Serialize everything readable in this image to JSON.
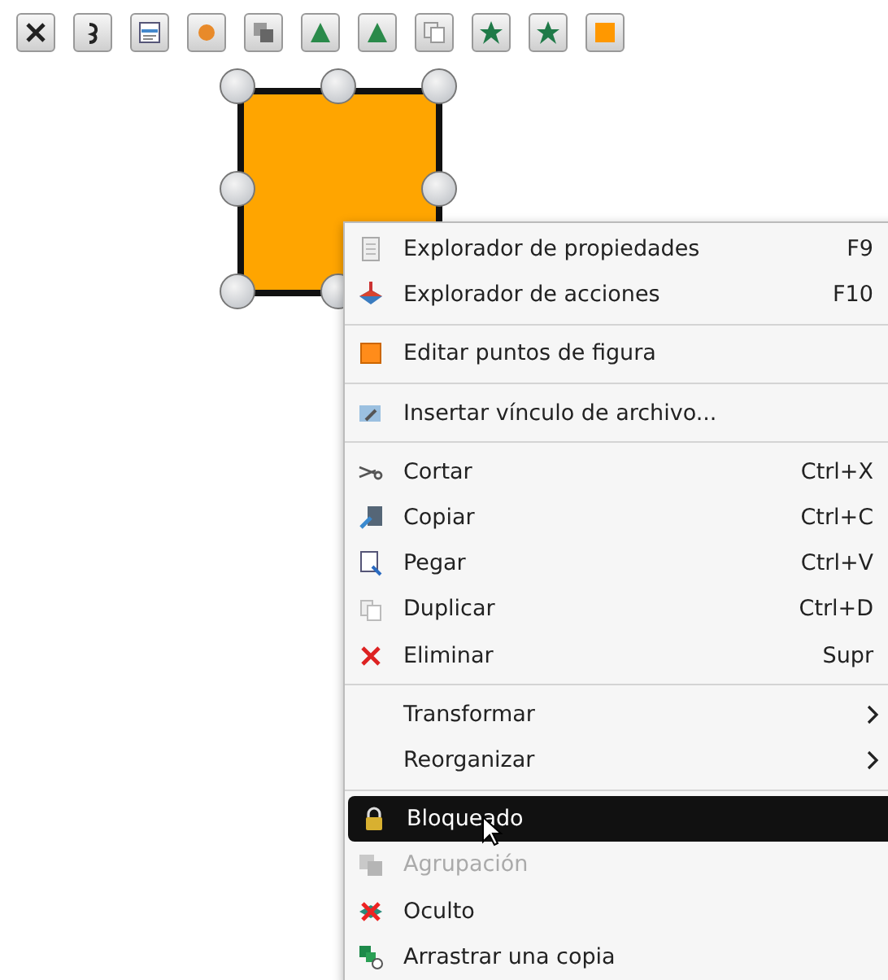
{
  "context_menu": {
    "items": [
      {
        "kind": "item",
        "label": "Explorador de propiedades",
        "shortcut": "F9",
        "selected": false,
        "disabled": false,
        "submenu": false
      },
      {
        "kind": "item",
        "label": "Explorador de acciones",
        "shortcut": "F10",
        "selected": false,
        "disabled": false,
        "submenu": false
      },
      {
        "kind": "separator"
      },
      {
        "kind": "item",
        "label": "Editar puntos de figura",
        "selected": false,
        "disabled": false,
        "submenu": false
      },
      {
        "kind": "separator"
      },
      {
        "kind": "item",
        "label": "Insertar vínculo de archivo...",
        "selected": false,
        "disabled": false,
        "submenu": false
      },
      {
        "kind": "separator"
      },
      {
        "kind": "item",
        "label": "Cortar",
        "shortcut": "Ctrl+X",
        "selected": false,
        "disabled": false,
        "submenu": false
      },
      {
        "kind": "item",
        "label": "Copiar",
        "shortcut": "Ctrl+C",
        "selected": false,
        "disabled": false,
        "submenu": false
      },
      {
        "kind": "item",
        "label": "Pegar",
        "shortcut": "Ctrl+V",
        "selected": false,
        "disabled": false,
        "submenu": false
      },
      {
        "kind": "item",
        "label": "Duplicar",
        "shortcut": "Ctrl+D",
        "selected": false,
        "disabled": false,
        "submenu": false
      },
      {
        "kind": "item",
        "label": "Eliminar",
        "shortcut": "Supr",
        "selected": false,
        "disabled": false,
        "submenu": false
      },
      {
        "kind": "separator"
      },
      {
        "kind": "item",
        "label": "Transformar",
        "selected": false,
        "disabled": false,
        "submenu": true
      },
      {
        "kind": "item",
        "label": "Reorganizar",
        "selected": false,
        "disabled": false,
        "submenu": true
      },
      {
        "kind": "separator"
      },
      {
        "kind": "item",
        "label": "Bloqueado",
        "selected": true,
        "disabled": false,
        "submenu": false
      },
      {
        "kind": "item",
        "label": "Agrupación",
        "selected": false,
        "disabled": true,
        "submenu": false
      },
      {
        "kind": "item",
        "label": "Oculto",
        "selected": false,
        "disabled": false,
        "submenu": false
      },
      {
        "kind": "item",
        "label": "Arrastrar una copia",
        "selected": false,
        "disabled": false,
        "submenu": false
      }
    ]
  }
}
